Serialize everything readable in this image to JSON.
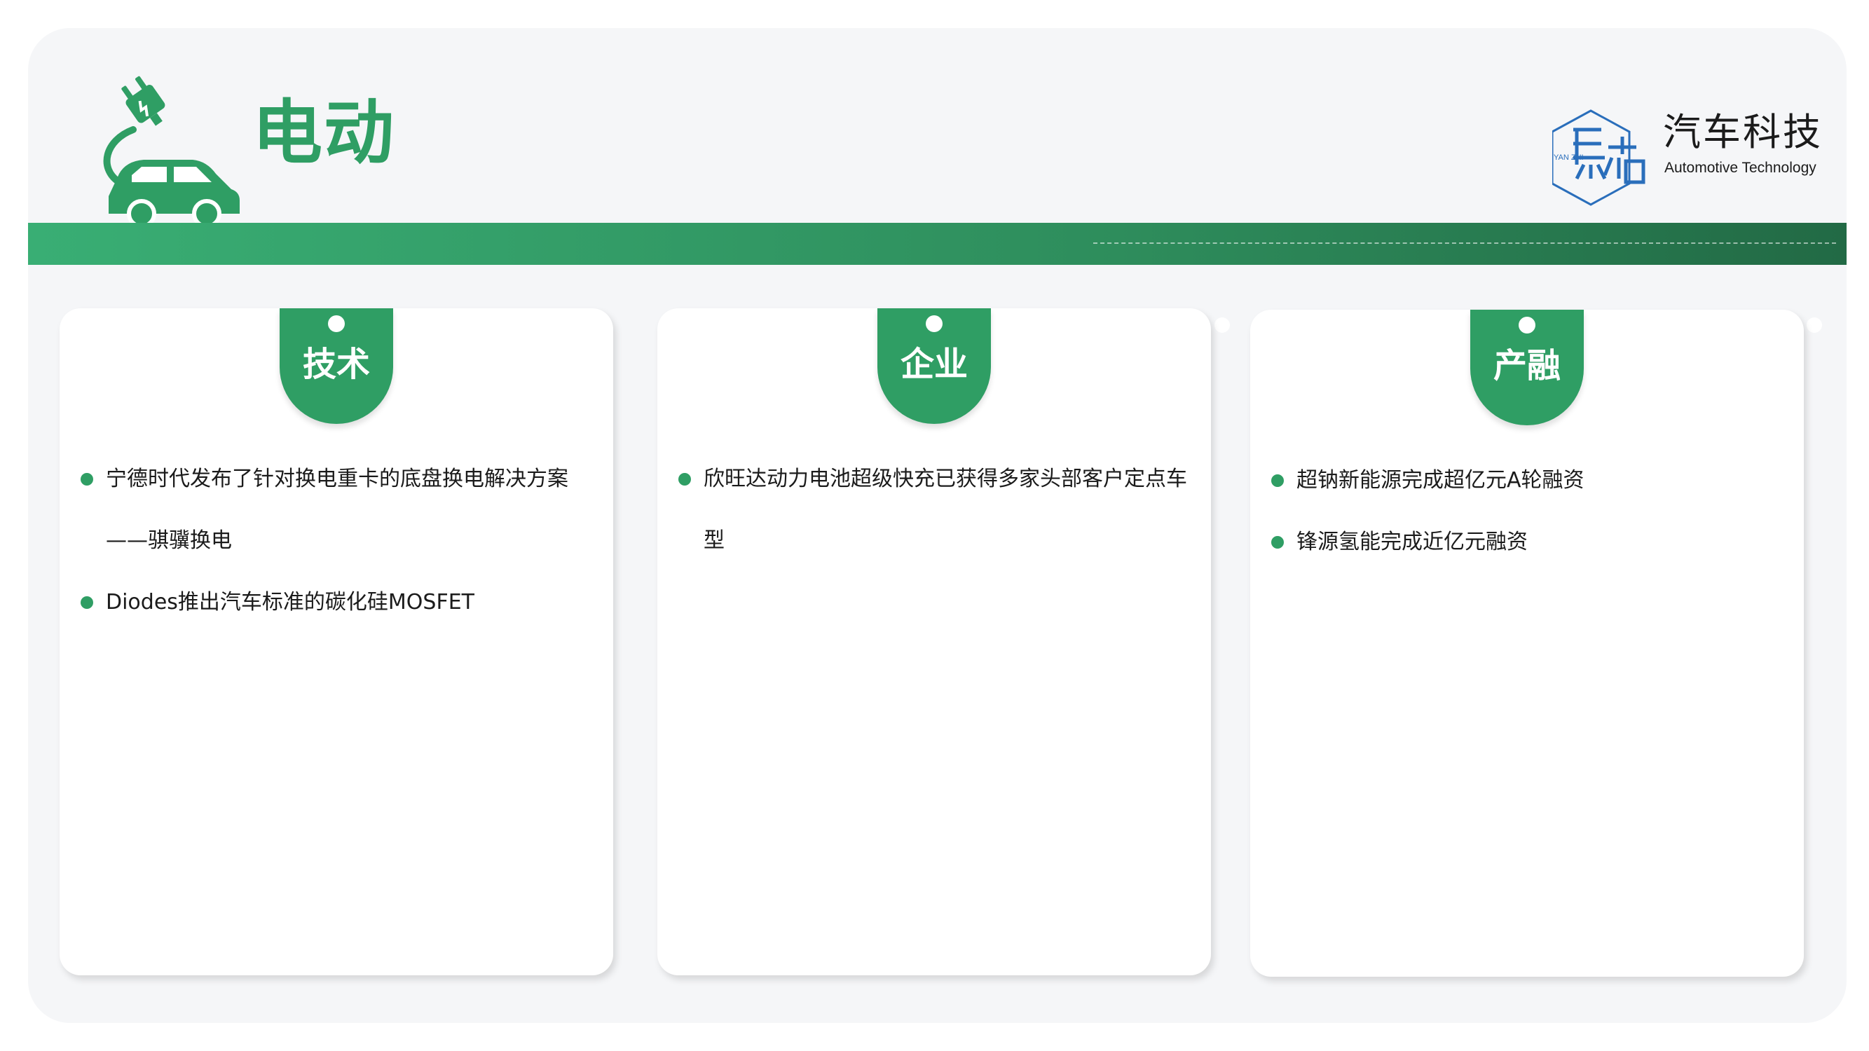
{
  "header": {
    "title": "电动"
  },
  "logo": {
    "mark_text": "YAN ZHI",
    "name_cn": "汽车科技",
    "name_en": "Automotive Technology"
  },
  "sections": [
    {
      "tab_label": "技术",
      "items": [
        "宁德时代发布了针对换电重卡的底盘换电解决方案——骐骥换电",
        "Diodes推出汽车标准的碳化硅MOSFET"
      ]
    },
    {
      "tab_label": "企业",
      "items": [
        "欣旺达动力电池超级快充已获得多家头部客户定点车型"
      ]
    },
    {
      "tab_label": "产融",
      "items": [
        "超钠新能源完成超亿元A轮融资",
        "锋源氢能完成近亿元融资"
      ]
    }
  ],
  "colors": {
    "accent": "#2f9e64",
    "band_dark": "#226a45",
    "background": "#f5f6f8",
    "logo_blue": "#2a6ebb"
  }
}
